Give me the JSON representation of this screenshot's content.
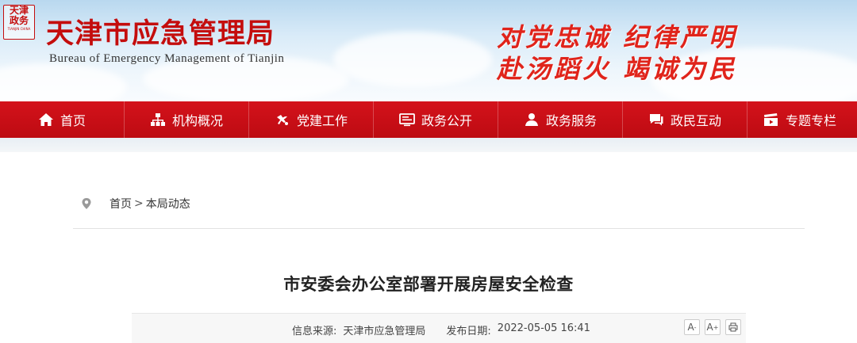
{
  "header": {
    "seal_text": [
      "天津",
      "政务"
    ],
    "seal_caption": "TIANJIN CHINA",
    "site_title": "天津市应急管理局",
    "site_subtitle": "Bureau of Emergency Management of Tianjin",
    "slogan_line1": "对党忠诚 纪律严明",
    "slogan_line2": "赴汤蹈火 竭诚为民"
  },
  "nav": {
    "items": [
      {
        "label": "首页",
        "icon": "home-icon"
      },
      {
        "label": "机构概况",
        "icon": "org-chart-icon"
      },
      {
        "label": "党建工作",
        "icon": "party-emblem-icon"
      },
      {
        "label": "政务公开",
        "icon": "monitor-icon"
      },
      {
        "label": "政务服务",
        "icon": "user-icon"
      },
      {
        "label": "政民互动",
        "icon": "chat-icon"
      },
      {
        "label": "专题专栏",
        "icon": "clapperboard-icon"
      }
    ]
  },
  "breadcrumb": {
    "home": "首页",
    "separator": ">",
    "current": "本局动态"
  },
  "article": {
    "title": "市安委会办公室部署开展房屋安全检查",
    "source_label": "信息来源:",
    "source": "天津市应急管理局",
    "date_label": "发布日期:",
    "date": "2022-05-05 16:41",
    "font_decrease": "A",
    "font_increase": "A"
  },
  "colors": {
    "brand_red": "#c40d0d",
    "nav_red": "#cc1019",
    "slogan_red": "#e0241b"
  }
}
